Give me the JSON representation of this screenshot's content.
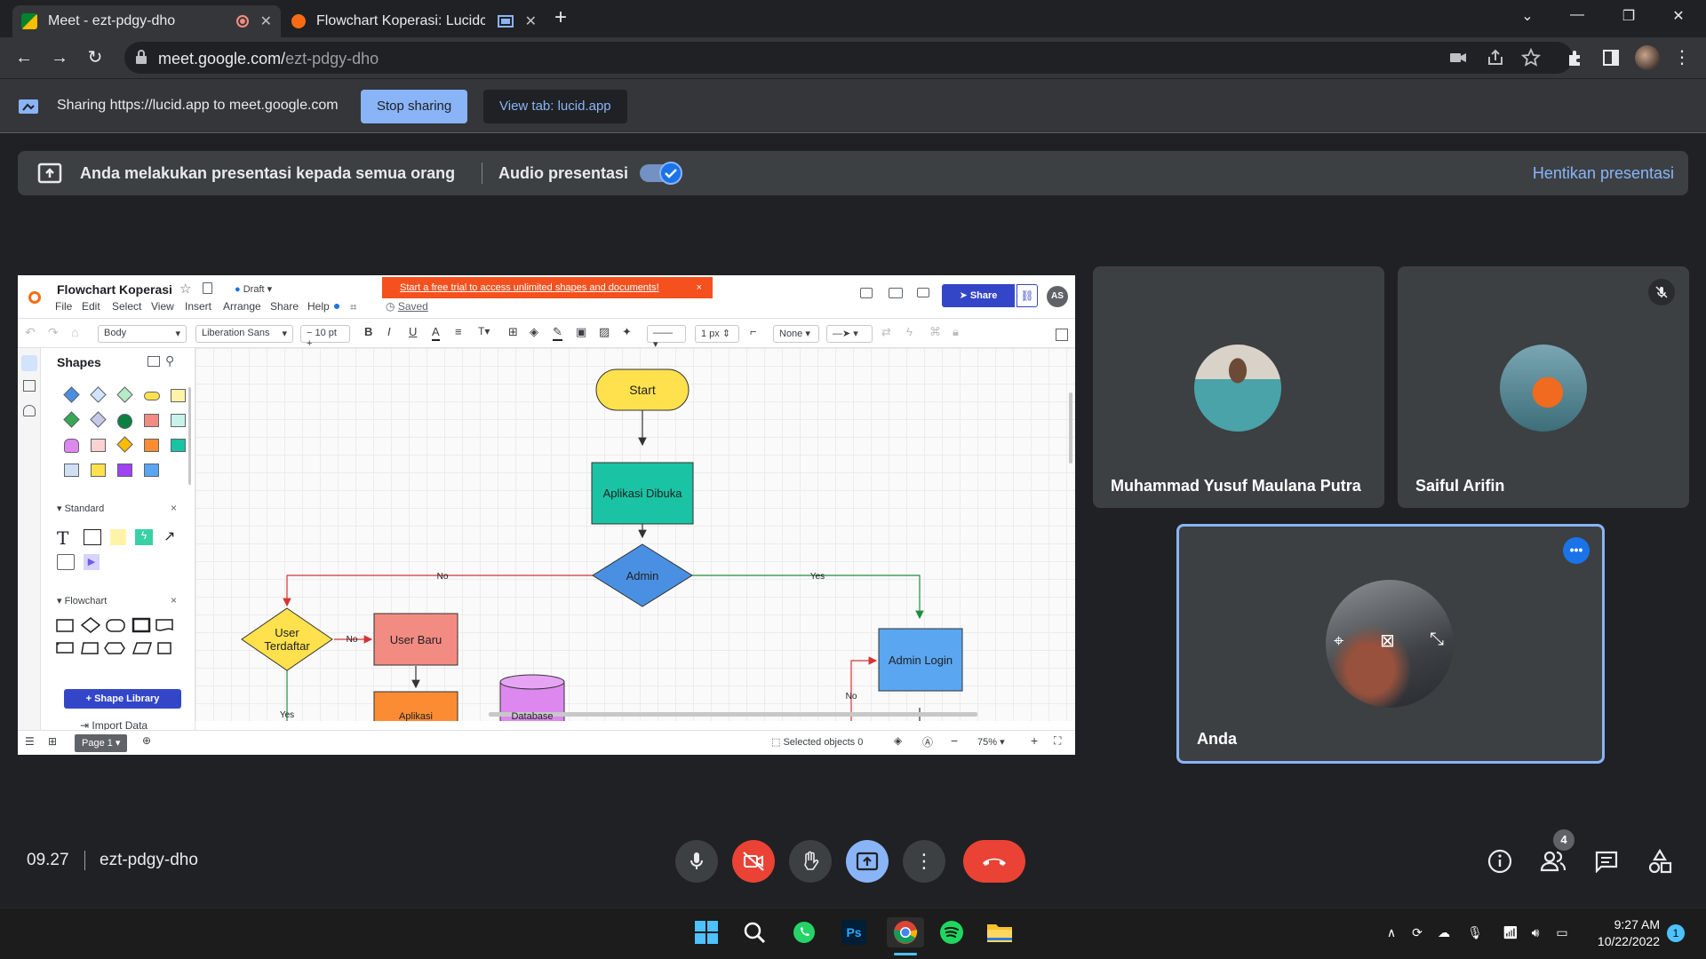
{
  "browser": {
    "tabs": [
      {
        "title": "Meet - ezt-pdgy-dho",
        "active": true
      },
      {
        "title": "Flowchart Koperasi: Lucidcha",
        "active": false
      }
    ],
    "url_host": "meet.google.com/",
    "url_path": "ezt-pdgy-dho"
  },
  "share_bar": {
    "text": "Sharing https://lucid.app to meet.google.com",
    "stop_label": "Stop sharing",
    "view_tab_label": "View tab: lucid.app"
  },
  "presenting_banner": {
    "message": "Anda melakukan presentasi kepada semua orang",
    "audio_label": "Audio presentasi",
    "stop_label": "Hentikan presentasi"
  },
  "lucid": {
    "doc_title": "Flowchart Koperasi",
    "status": "Draft",
    "saved": "Saved",
    "trial_banner": "Start a free trial to access unlimited shapes and documents!",
    "menu": [
      "File",
      "Edit",
      "Select",
      "View",
      "Insert",
      "Arrange",
      "Share",
      "Help"
    ],
    "share_label": "Share",
    "avatar_initials": "AS",
    "format": {
      "style": "Body",
      "font": "Liberation Sans",
      "size": "10 pt",
      "line_width": "1 px",
      "arrow": "None"
    },
    "sidebar": {
      "title": "Shapes",
      "standard_label": "Standard",
      "flowchart_label": "Flowchart",
      "shape_library_label": "Shape Library",
      "import_label": "Import Data"
    },
    "flowchart": {
      "start": "Start",
      "aplikasi_dibuka": "Aplikasi Dibuka",
      "admin": "Admin",
      "user_terdaftar_1": "User",
      "user_terdaftar_2": "Terdaftar",
      "user_baru": "User Baru",
      "admin_login": "Admin Login",
      "aplikasi_partial": "Aplikasi",
      "database_partial": "Database",
      "no": "No",
      "yes": "Yes"
    },
    "bottom": {
      "page": "Page 1",
      "selected": "Selected objects",
      "selected_count": "0",
      "zoom": "75%"
    }
  },
  "participants": [
    {
      "name": "Muhammad Yusuf Maulana Putra"
    },
    {
      "name": "Saiful Arifin",
      "muted": true
    },
    {
      "name": "Anda"
    }
  ],
  "meeting": {
    "time": "09.27",
    "code": "ezt-pdgy-dho",
    "people_count": "4"
  },
  "taskbar": {
    "clock_time": "9:27 AM",
    "clock_date": "10/22/2022",
    "notification_count": "1"
  }
}
